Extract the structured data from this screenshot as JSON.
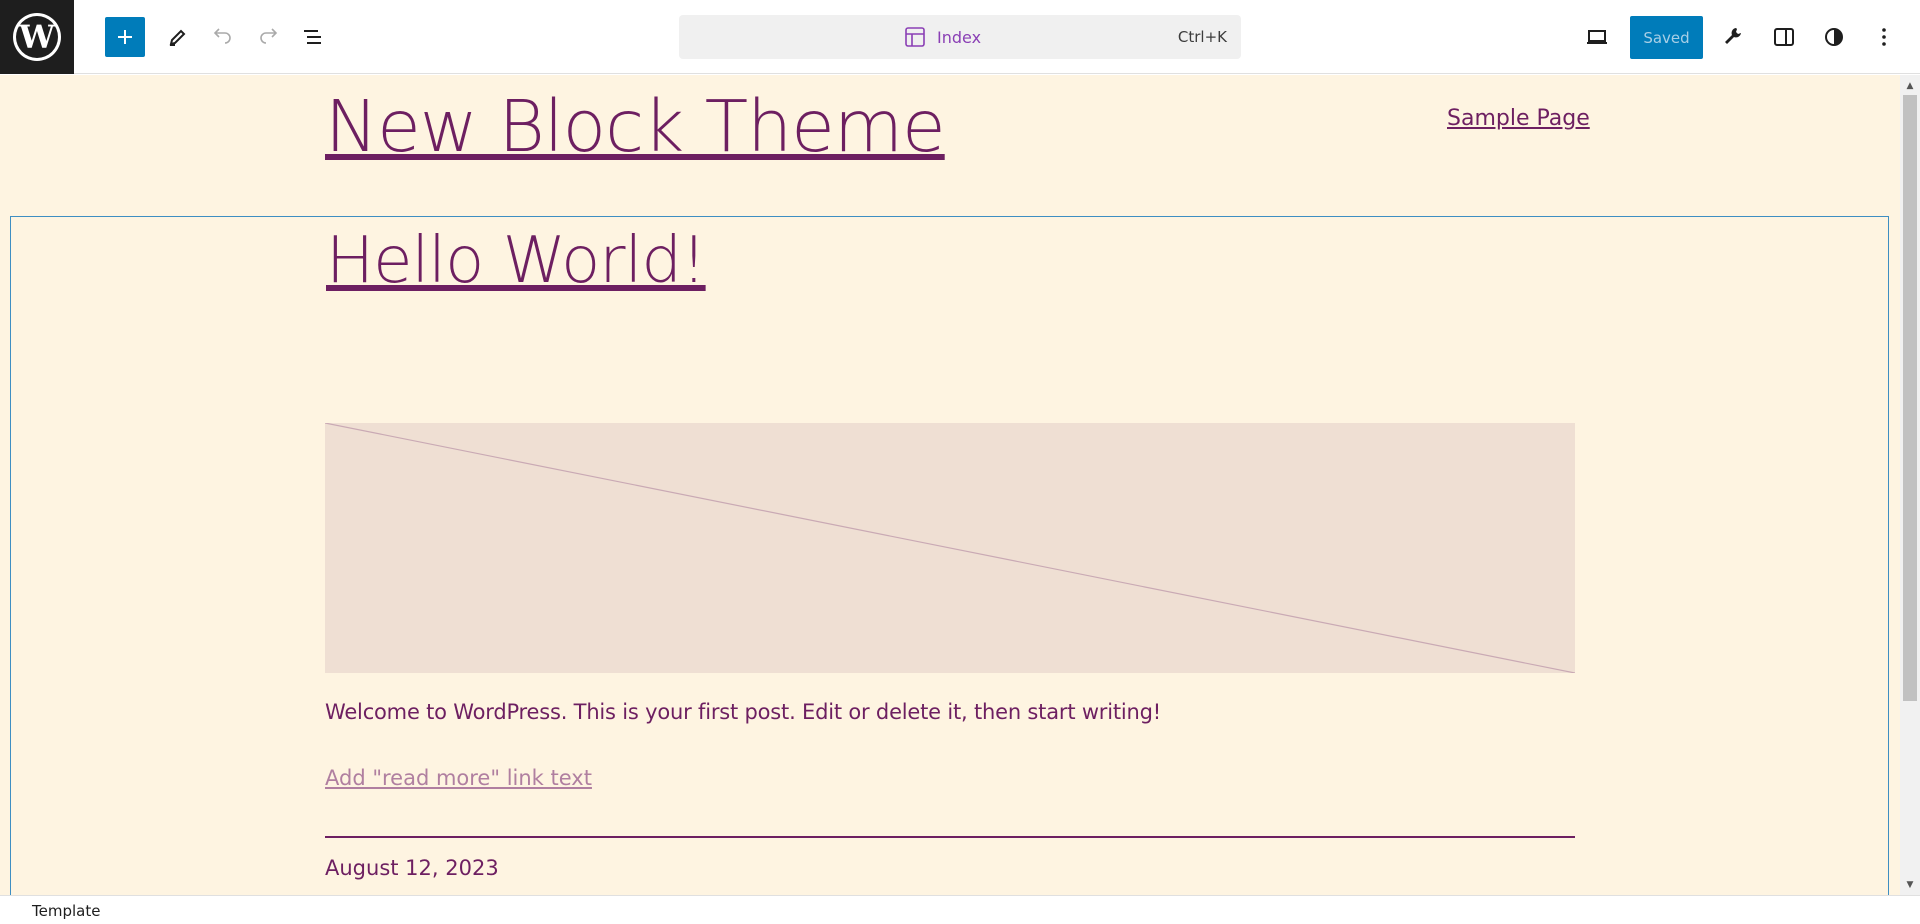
{
  "toolbar": {
    "add_label": "Add block",
    "command": {
      "label": "Index",
      "shortcut": "Ctrl+K"
    },
    "saved_label": "Saved"
  },
  "canvas": {
    "site_title": "New Block Theme",
    "nav_link": "Sample Page",
    "post": {
      "title": "Hello World!",
      "excerpt": "Welcome to WordPress. This is your first post. Edit or delete it, then start writing!",
      "read_more": "Add \"read more\" link text",
      "date": "August 12, 2023"
    }
  },
  "footer": {
    "breadcrumb": "Template"
  },
  "colors": {
    "accent": "#007cba",
    "canvas_bg": "#fef4e1",
    "text": "#6d1f61",
    "command_label": "#8a3fb5"
  }
}
